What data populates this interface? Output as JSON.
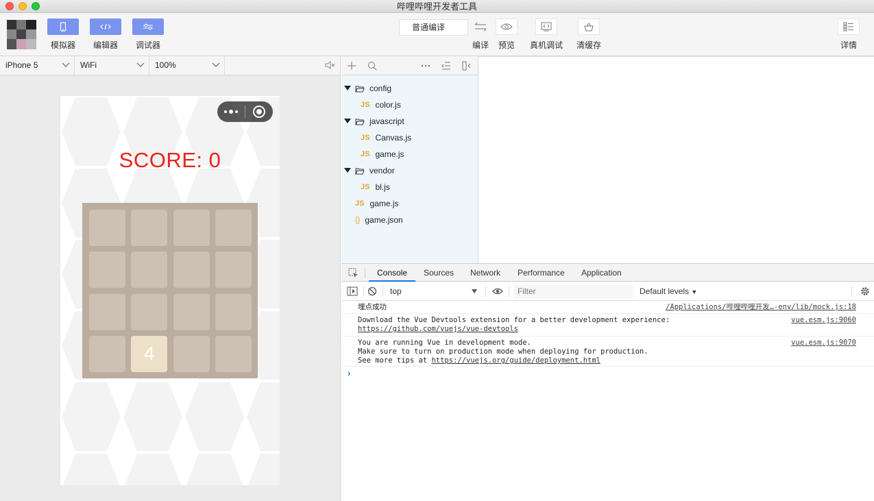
{
  "window": {
    "title": "哔哩哔哩开发者工具"
  },
  "toolbar": {
    "left_buttons": [
      {
        "label": "模拟器",
        "icon": "phone-icon"
      },
      {
        "label": "编辑器",
        "icon": "code-icon"
      },
      {
        "label": "调试器",
        "icon": "sliders-icon"
      }
    ],
    "compile_mode": "普通编译",
    "actions": [
      {
        "label": "编译",
        "icon": "compile-arrows-icon"
      },
      {
        "label": "预览",
        "icon": "eye-icon"
      },
      {
        "label": "真机调试",
        "icon": "device-debug-icon"
      },
      {
        "label": "清缓存",
        "icon": "clear-cache-icon"
      }
    ],
    "details_label": "详情",
    "accent_color": "#7a93ef"
  },
  "simulator": {
    "device": "iPhone 5",
    "network": "WiFi",
    "zoom": "100%",
    "game": {
      "score_text": "SCORE: 0",
      "tiles": [
        [
          "",
          "",
          "",
          ""
        ],
        [
          "",
          "",
          "",
          ""
        ],
        [
          "",
          "",
          "",
          ""
        ],
        [
          "",
          "4",
          "",
          ""
        ]
      ],
      "colors": {
        "board": "#bbada0",
        "empty": "#cdc1b4",
        "tile_4": "#ede0c8",
        "score": "#e8241b"
      }
    }
  },
  "file_tree": [
    {
      "name": "config",
      "type": "folder",
      "expanded": true
    },
    {
      "name": "color.js",
      "type": "js"
    },
    {
      "name": "javascript",
      "type": "folder",
      "expanded": true
    },
    {
      "name": "Canvas.js",
      "type": "js"
    },
    {
      "name": "game.js",
      "type": "js"
    },
    {
      "name": "vendor",
      "type": "folder",
      "expanded": true
    },
    {
      "name": "bl.js",
      "type": "js"
    },
    {
      "name": "game.js",
      "type": "js"
    },
    {
      "name": "game.json",
      "type": "json"
    }
  ],
  "devtools": {
    "tabs": [
      "Console",
      "Sources",
      "Network",
      "Performance",
      "Application"
    ],
    "active_tab": "Console",
    "context": "top",
    "filter_placeholder": "Filter",
    "levels": "Default levels",
    "logs": [
      {
        "message": "埋点成功",
        "source": "/Applications/哔哩哔哩开发…-env/lib/mock.js:18"
      },
      {
        "message": "Download the Vue Devtools extension for a better development experience:",
        "link": "https://github.com/vuejs/vue-devtools",
        "source": "vue.esm.js:9060"
      },
      {
        "message": "You are running Vue in development mode.",
        "message2": "Make sure to turn on production mode when deploying for production.",
        "message3_prefix": "See more tips at ",
        "link": "https://vuejs.org/guide/deployment.html",
        "source": "vue.esm.js:9070"
      }
    ],
    "prompt": "›"
  }
}
